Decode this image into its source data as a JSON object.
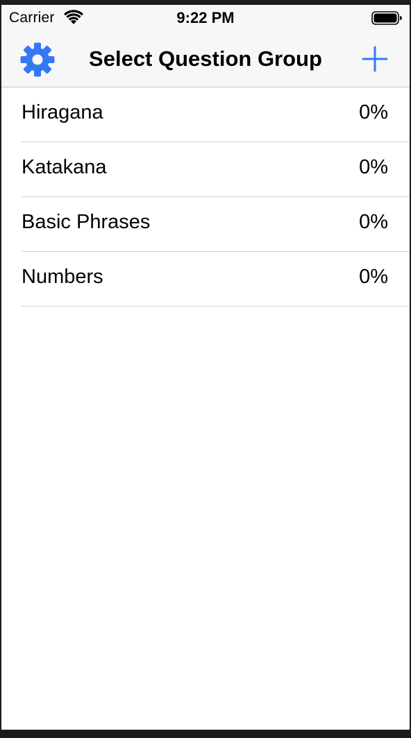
{
  "status_bar": {
    "carrier": "Carrier",
    "time": "9:22 PM",
    "wifi_icon": "wifi-icon",
    "battery_icon": "battery-icon"
  },
  "nav": {
    "title": "Select Question Group",
    "left_icon": "gear-icon",
    "right_icon": "plus-icon",
    "accent_color": "#3478f6"
  },
  "groups": [
    {
      "label": "Hiragana",
      "progress": "0%"
    },
    {
      "label": "Katakana",
      "progress": "0%"
    },
    {
      "label": "Basic Phrases",
      "progress": "0%"
    },
    {
      "label": "Numbers",
      "progress": "0%"
    }
  ]
}
